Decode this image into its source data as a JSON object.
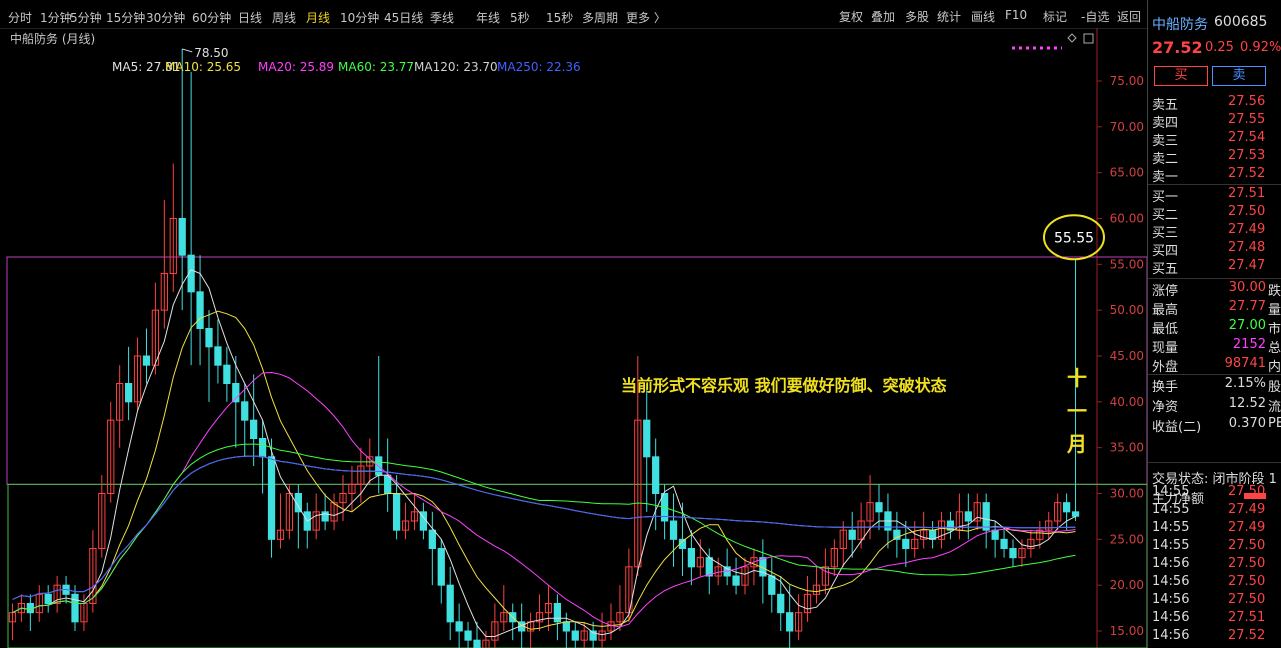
{
  "toolbar": {
    "periods": [
      "分时",
      "1分钟",
      "5分钟",
      "15分钟",
      "30分钟",
      "60分钟",
      "日线",
      "周线",
      "月线",
      "10分钟",
      "45日线",
      "季线",
      "年线",
      "5秒",
      "15秒",
      "多周期",
      "更多 〉"
    ],
    "active_period": "月线",
    "right_buttons": [
      "复权",
      "叠加",
      "多股",
      "统计",
      "画线",
      "F10",
      "标记",
      "-自选",
      "返回"
    ]
  },
  "chart_header": {
    "stock_label": "中船防务 (月线)",
    "ma_items": [
      {
        "label": "MA5: 27.81",
        "color": "#e0e0e0"
      },
      {
        "label": "MA10: 25.65",
        "color": "#f0e040"
      },
      {
        "label": "MA20: 25.89",
        "color": "#ff40ff"
      },
      {
        "label": "MA60: 23.77",
        "color": "#40ff40"
      },
      {
        "label": "MA120: 23.70",
        "color": "#d0d0d0"
      },
      {
        "label": "MA250: 22.36",
        "color": "#4060ff"
      }
    ]
  },
  "annotations": {
    "high_label": "78.50",
    "circle_value": "55.55",
    "headline": "当前形式不容乐观   我们要做好防御、突破状态",
    "month_chars": [
      "十",
      "一",
      "月"
    ]
  },
  "chart_data": {
    "type": "candlestick",
    "ylim": [
      12,
      80
    ],
    "y_ticks": [
      "75.00",
      "70.00",
      "65.00",
      "60.00",
      "55.00",
      "50.00",
      "45.00",
      "40.00",
      "35.00",
      "30.00",
      "25.00",
      "20.00",
      "15.00"
    ],
    "candles": [
      [
        16,
        17,
        14,
        18
      ],
      [
        17,
        18,
        16,
        19
      ],
      [
        18,
        17,
        15,
        19
      ],
      [
        17,
        19,
        16,
        20
      ],
      [
        19,
        18,
        17,
        20
      ],
      [
        18,
        20,
        17,
        21
      ],
      [
        20,
        19,
        18,
        21
      ],
      [
        19,
        16,
        15,
        20
      ],
      [
        16,
        18,
        15,
        19
      ],
      [
        18,
        24,
        17,
        26
      ],
      [
        24,
        30,
        23,
        32
      ],
      [
        30,
        38,
        29,
        40
      ],
      [
        38,
        42,
        35,
        44
      ],
      [
        42,
        40,
        38,
        46
      ],
      [
        40,
        45,
        39,
        47
      ],
      [
        45,
        44,
        42,
        48
      ],
      [
        44,
        50,
        43,
        53
      ],
      [
        50,
        54,
        48,
        62
      ],
      [
        54,
        60,
        52,
        66
      ],
      [
        60,
        56,
        50,
        78.5
      ],
      [
        56,
        52,
        44,
        76
      ],
      [
        52,
        48,
        44,
        56
      ],
      [
        48,
        46,
        40,
        50
      ],
      [
        46,
        44,
        42,
        49
      ],
      [
        44,
        42,
        40,
        46
      ],
      [
        42,
        40,
        35,
        45
      ],
      [
        40,
        38,
        34,
        42
      ],
      [
        38,
        36,
        33,
        43
      ],
      [
        36,
        34,
        30,
        38
      ],
      [
        34,
        25,
        23,
        36
      ],
      [
        25,
        26,
        24,
        30
      ],
      [
        26,
        30,
        25,
        31
      ],
      [
        30,
        28,
        24,
        31
      ],
      [
        28,
        26,
        24,
        29
      ],
      [
        26,
        28,
        25,
        30
      ],
      [
        28,
        27,
        26,
        30
      ],
      [
        27,
        29,
        26,
        30
      ],
      [
        29,
        30,
        27,
        32
      ],
      [
        30,
        31,
        28,
        33
      ],
      [
        31,
        33,
        29,
        35
      ],
      [
        33,
        34,
        31,
        36
      ],
      [
        34,
        32,
        30,
        45
      ],
      [
        32,
        30,
        28,
        36
      ],
      [
        30,
        26,
        25,
        32
      ],
      [
        26,
        27,
        25,
        29
      ],
      [
        27,
        28,
        26,
        30
      ],
      [
        28,
        26,
        25,
        29
      ],
      [
        26,
        24,
        20,
        28
      ],
      [
        24,
        20,
        18,
        25
      ],
      [
        20,
        16,
        14,
        22
      ],
      [
        16,
        15,
        13,
        18
      ],
      [
        15,
        14,
        12,
        16
      ],
      [
        14,
        13,
        12,
        16
      ],
      [
        13,
        14,
        12,
        15
      ],
      [
        14,
        16,
        12,
        18
      ],
      [
        16,
        17,
        15,
        20
      ],
      [
        17,
        16,
        14,
        18
      ],
      [
        16,
        15,
        13,
        18
      ],
      [
        15,
        16,
        13,
        17
      ],
      [
        16,
        17,
        15,
        19
      ],
      [
        17,
        18,
        15,
        20
      ],
      [
        18,
        16,
        14,
        19
      ],
      [
        16,
        15,
        13,
        17
      ],
      [
        15,
        14,
        13,
        16
      ],
      [
        14,
        15,
        13,
        16
      ],
      [
        15,
        14,
        13,
        16
      ],
      [
        14,
        15,
        13,
        17
      ],
      [
        15,
        16,
        14,
        18
      ],
      [
        16,
        17,
        15,
        20
      ],
      [
        17,
        22,
        16,
        24
      ],
      [
        22,
        38,
        21,
        45
      ],
      [
        38,
        34,
        28,
        42
      ],
      [
        34,
        30,
        26,
        36
      ],
      [
        30,
        27,
        25,
        31
      ],
      [
        27,
        25,
        22,
        30
      ],
      [
        25,
        24,
        21,
        29
      ],
      [
        24,
        22,
        20,
        26
      ],
      [
        22,
        23,
        21,
        25
      ],
      [
        23,
        21,
        19,
        24
      ],
      [
        21,
        22,
        20,
        23
      ],
      [
        22,
        21,
        20,
        24
      ],
      [
        21,
        20,
        19,
        23
      ],
      [
        20,
        22,
        19,
        23
      ],
      [
        22,
        23,
        20,
        24
      ],
      [
        23,
        21,
        18,
        25
      ],
      [
        21,
        19,
        17,
        23
      ],
      [
        19,
        17,
        15,
        21
      ],
      [
        17,
        15,
        13,
        20
      ],
      [
        15,
        17,
        14,
        19
      ],
      [
        17,
        19,
        16,
        21
      ],
      [
        19,
        20,
        18,
        22
      ],
      [
        20,
        22,
        19,
        24
      ],
      [
        22,
        24,
        21,
        25
      ],
      [
        24,
        26,
        22,
        27
      ],
      [
        26,
        25,
        23,
        28
      ],
      [
        25,
        27,
        24,
        29
      ],
      [
        27,
        29,
        25,
        32
      ],
      [
        29,
        28,
        26,
        31
      ],
      [
        28,
        26,
        24,
        30
      ],
      [
        26,
        25,
        23,
        28
      ],
      [
        25,
        24,
        22,
        27
      ],
      [
        24,
        25,
        23,
        27
      ],
      [
        25,
        26,
        24,
        28
      ],
      [
        26,
        25,
        24,
        27
      ],
      [
        25,
        27,
        24,
        28
      ],
      [
        27,
        26,
        25,
        28
      ],
      [
        26,
        28,
        25,
        30
      ],
      [
        28,
        27,
        25,
        30
      ],
      [
        27,
        29,
        26,
        30
      ],
      [
        29,
        26,
        24,
        30
      ],
      [
        26,
        25,
        23,
        27
      ],
      [
        25,
        24,
        23,
        26
      ],
      [
        24,
        23,
        22,
        25
      ],
      [
        23,
        24,
        22,
        25
      ],
      [
        24,
        25,
        23,
        26
      ],
      [
        25,
        26,
        24,
        27
      ],
      [
        26,
        27,
        25,
        28
      ],
      [
        27,
        29,
        26,
        30
      ],
      [
        29,
        28,
        26,
        30
      ],
      [
        28,
        27.52,
        27,
        55.55
      ]
    ]
  },
  "right_panel": {
    "stock_name": "中船防务",
    "stock_code": "600685",
    "price": "27.52",
    "change": "0.25",
    "change_pct": "0.92%",
    "buy_button": "买",
    "sell_button": "卖",
    "asks": [
      {
        "label": "卖五",
        "price": "27.56"
      },
      {
        "label": "卖四",
        "price": "27.55"
      },
      {
        "label": "卖三",
        "price": "27.54"
      },
      {
        "label": "卖二",
        "price": "27.53"
      },
      {
        "label": "卖一",
        "price": "27.52"
      }
    ],
    "bids": [
      {
        "label": "买一",
        "price": "27.51"
      },
      {
        "label": "买二",
        "price": "27.50"
      },
      {
        "label": "买三",
        "price": "27.49"
      },
      {
        "label": "买四",
        "price": "27.48"
      },
      {
        "label": "买五",
        "price": "27.47"
      }
    ],
    "stats": [
      {
        "label": "涨停",
        "value": "30.00",
        "color": "#ff4444",
        "extra": "跌"
      },
      {
        "label": "最高",
        "value": "27.77",
        "color": "#ff4444",
        "extra": "量"
      },
      {
        "label": "最低",
        "value": "27.00",
        "color": "#40ff40",
        "extra": "市"
      },
      {
        "label": "现量",
        "value": "2152",
        "color": "#ff40ff",
        "extra": "总"
      },
      {
        "label": "外盘",
        "value": "98741",
        "color": "#ff4444",
        "extra": "内"
      }
    ],
    "stats2": [
      {
        "label": "换手",
        "value": "2.15%",
        "extra": "股"
      },
      {
        "label": "净资",
        "value": "12.52",
        "extra": "流"
      },
      {
        "label": "收益(二)",
        "value": "0.370",
        "extra": "PE"
      }
    ],
    "trade_status": "交易状态: 闭市阶段 1",
    "main_net": "主力净额",
    "ticks": [
      {
        "time": "14:55",
        "price": "27.50"
      },
      {
        "time": "14:55",
        "price": "27.49"
      },
      {
        "time": "14:55",
        "price": "27.49"
      },
      {
        "time": "14:55",
        "price": "27.50"
      },
      {
        "time": "14:56",
        "price": "27.50"
      },
      {
        "time": "14:56",
        "price": "27.50"
      },
      {
        "time": "14:56",
        "price": "27.50"
      },
      {
        "time": "14:56",
        "price": "27.51"
      },
      {
        "time": "14:56",
        "price": "27.52"
      }
    ]
  }
}
